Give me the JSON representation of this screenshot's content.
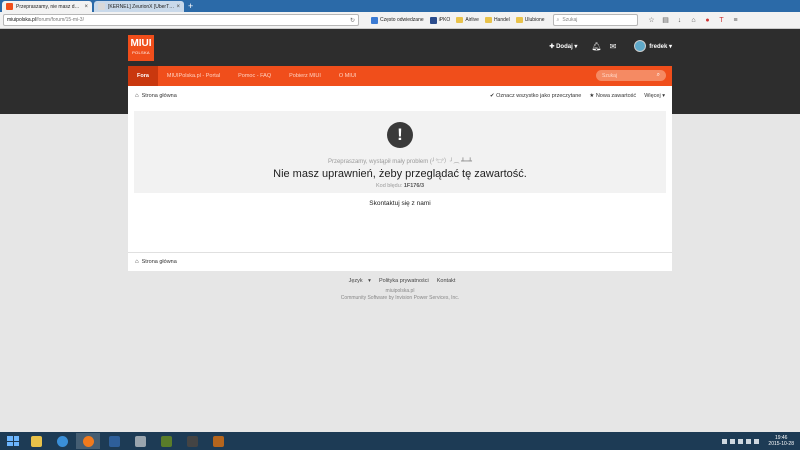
{
  "browser": {
    "tabs": [
      {
        "label": "Przepraszamy, nie masz d…",
        "active": true
      },
      {
        "label": "[KERNEL] ZeurionX [UberT…",
        "active": false
      }
    ],
    "url_host": "miuipolska.pl",
    "url_path": "/forum/forum/15-mi-3/",
    "bookmarks": [
      "Często odwiedzane",
      "iPKO",
      "Airlive",
      "Handel",
      "Ulubione"
    ],
    "search_placeholder": "Szukaj"
  },
  "site": {
    "logo_main": "MIUI",
    "logo_sub": "POLSKA",
    "add_label": "Dodaj",
    "username": "fredek",
    "nav": [
      {
        "label": "Fora",
        "active": true
      },
      {
        "label": "MIUIPolska.pl - Portal",
        "active": false
      },
      {
        "label": "Pomoc - FAQ",
        "active": false
      },
      {
        "label": "Pobierz MIUI",
        "active": false
      },
      {
        "label": "O MIUI",
        "active": false
      }
    ],
    "search_placeholder": "Szukaj"
  },
  "breadcrumb": {
    "home": "Strona główna",
    "mark_read": "Oznacz wszystko jako przeczytane",
    "new_content": "Nowa zawartość",
    "more": "Więcej"
  },
  "error": {
    "sorry": "Przepraszamy, wystąpił mały problem (╯°□°）╯︵ ┻━┻",
    "title": "Nie masz uprawnień, żeby przeglądać tę zawartość.",
    "code_label": "Kod błędu:",
    "code": "1F176/3",
    "contact": "Skontaktuj się z nami"
  },
  "footer": {
    "language": "Język",
    "privacy": "Polityka prywatności",
    "contact": "Kontakt",
    "site": "miuipolska.pl",
    "copyright": "Community Software by Invision Power Services, Inc."
  },
  "taskbar": {
    "time": "19:46",
    "date": "2015-10-28"
  },
  "colors": {
    "brand_orange": "#f04e1b",
    "header_dark": "#2d2d2d",
    "nav_active": "#c9380e"
  }
}
